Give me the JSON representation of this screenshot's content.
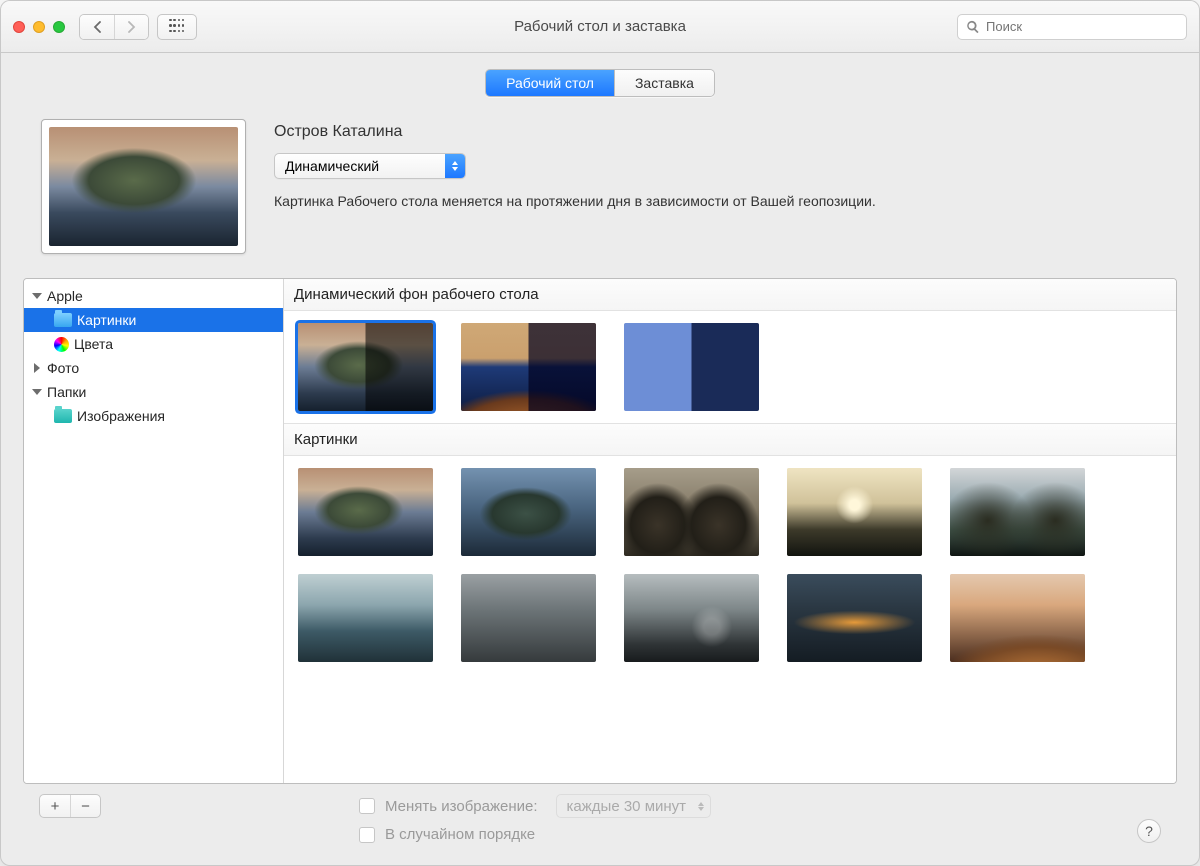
{
  "window": {
    "title": "Рабочий стол и заставка"
  },
  "search": {
    "placeholder": "Поиск"
  },
  "tabs": {
    "desktop": "Рабочий стол",
    "screensaver": "Заставка"
  },
  "wallpaper": {
    "name": "Остров Каталина",
    "mode": "Динамический",
    "description": "Картинка Рабочего стола меняется на протяжении дня в зависимости от Вашей геопозиции."
  },
  "sidebar": {
    "apple": "Apple",
    "pictures": "Картинки",
    "colors": "Цвета",
    "photos": "Фото",
    "folders": "Папки",
    "images": "Изображения"
  },
  "sections": {
    "dynamic": "Динамический фон рабочего стола",
    "pictures": "Картинки"
  },
  "bottom": {
    "change": "Менять изображение:",
    "every": "каждые 30 минут",
    "random": "В случайном порядке"
  }
}
